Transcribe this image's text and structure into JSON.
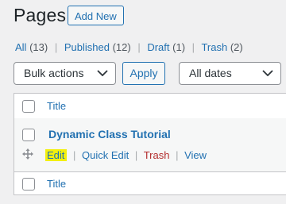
{
  "header": {
    "title": "Pages",
    "add_new_label": "Add New"
  },
  "filters": [
    {
      "label": "All",
      "count": "(13)"
    },
    {
      "label": "Published",
      "count": "(12)"
    },
    {
      "label": "Draft",
      "count": "(1)"
    },
    {
      "label": "Trash",
      "count": "(2)"
    }
  ],
  "separator": "|",
  "toolbar": {
    "bulk_actions": "Bulk actions",
    "apply_label": "Apply",
    "dates": "All dates"
  },
  "table": {
    "column_title": "Title",
    "rows": [
      {
        "title": "Dynamic Class Tutorial",
        "actions": {
          "edit": "Edit",
          "quick_edit": "Quick Edit",
          "trash": "Trash",
          "view": "View"
        }
      }
    ],
    "footer_title": "Title"
  },
  "icons": {
    "drag": "move-icon",
    "chevron": "chevron-down-icon"
  },
  "colors": {
    "link": "#2271b1",
    "trash": "#b32d2e",
    "highlight": "#f3f00e"
  }
}
